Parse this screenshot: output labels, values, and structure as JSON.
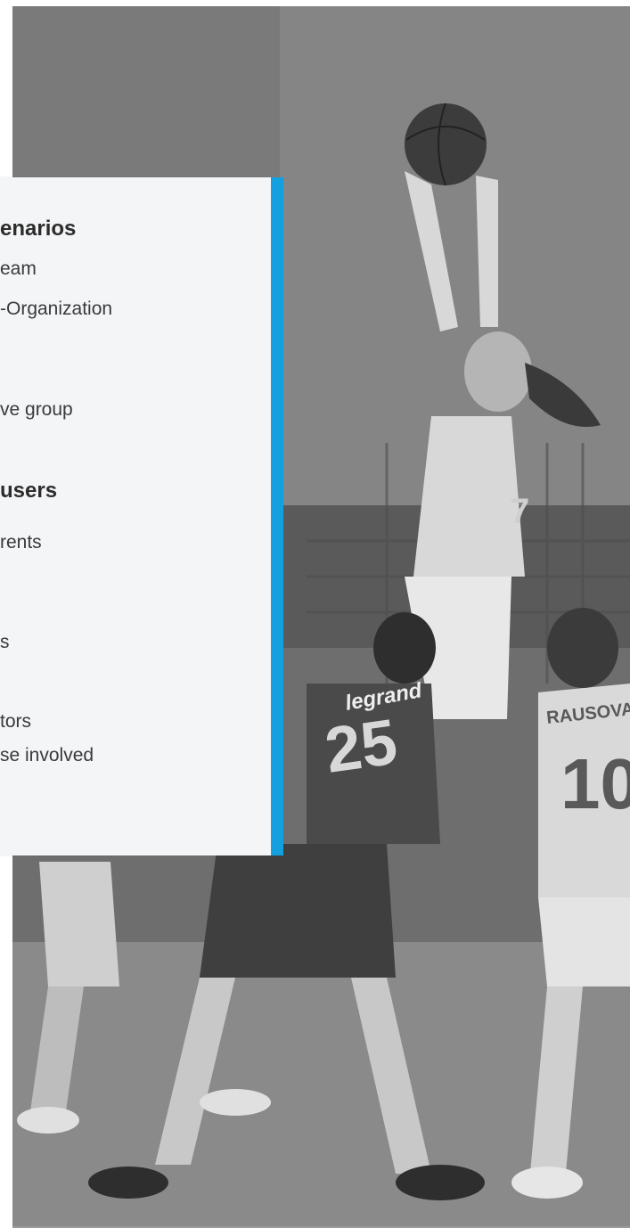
{
  "card": {
    "section1": {
      "heading": "enarios",
      "items": [
        "eam",
        "-Organization",
        "ve group"
      ]
    },
    "section2": {
      "heading": " users",
      "items": [
        "rents",
        "s",
        "tors",
        "se involved"
      ]
    }
  },
  "photo": {
    "description_icon": "basketball-photo",
    "jersey_numbers": [
      "25",
      "10",
      "7"
    ],
    "jersey_text": [
      "legrand",
      "RAUSOVA"
    ]
  },
  "colors": {
    "accent": "#149fdf",
    "card_bg": "#f4f5f7"
  }
}
